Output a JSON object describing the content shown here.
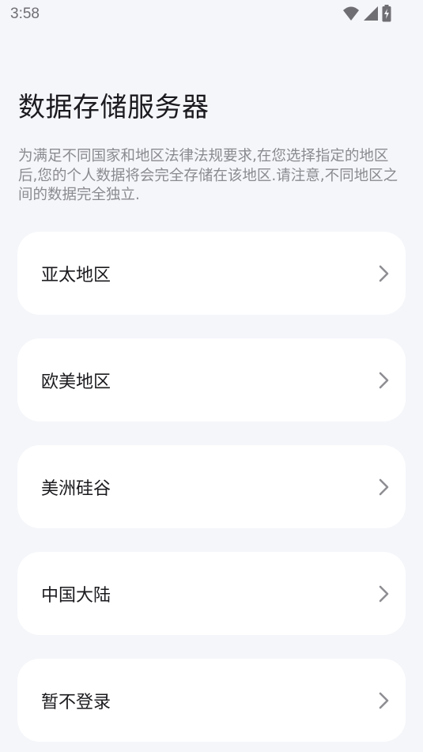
{
  "status_bar": {
    "time": "3:58",
    "icons": [
      "wifi-icon",
      "cellular-signal-icon",
      "battery-charging-icon"
    ]
  },
  "header": {
    "title": "数据存储服务器",
    "description": "为满足不同国家和地区法律法规要求,在您选择指定的地区后,您的个人数据将会完全存储在该地区.请注意,不同地区之间的数据完全独立."
  },
  "options": [
    {
      "label": "亚太地区",
      "icon": "chevron-right-icon"
    },
    {
      "label": "欧美地区",
      "icon": "chevron-right-icon"
    },
    {
      "label": "美洲硅谷",
      "icon": "chevron-right-icon"
    },
    {
      "label": "中国大陆",
      "icon": "chevron-right-icon"
    },
    {
      "label": "暂不登录",
      "icon": "chevron-right-icon"
    }
  ],
  "colors": {
    "background": "#f5f6fa",
    "card": "#ffffff",
    "title_text": "#1b1b1f",
    "secondary_text": "#8a8b90",
    "chevron": "#8e8e93"
  }
}
